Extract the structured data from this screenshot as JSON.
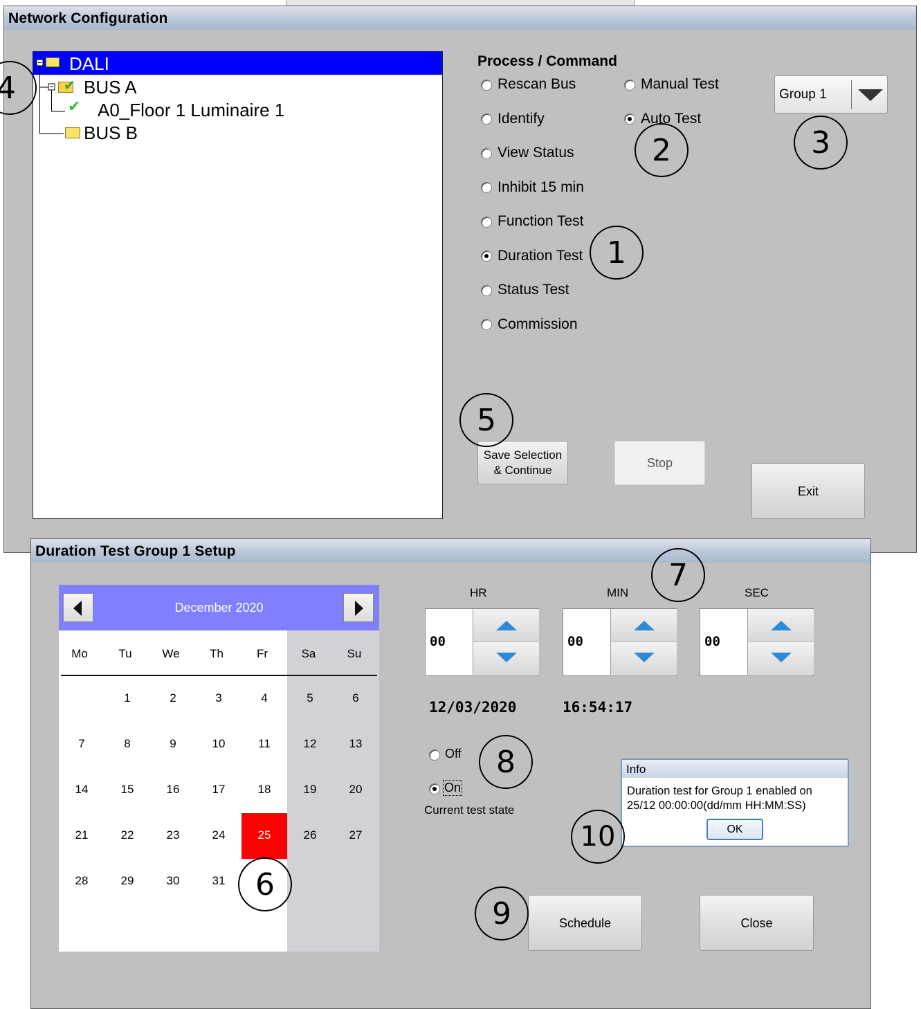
{
  "network_window": {
    "title": "Network Configuration",
    "tree": {
      "root": "DALI",
      "bus_a": "BUS A",
      "device": "A0_Floor 1 Luminaire 1",
      "bus_b": "BUS B"
    },
    "process_heading": "Process / Command",
    "commands_left": [
      "Rescan Bus",
      "Identify",
      "View Status",
      "Inhibit 15 min",
      "Function Test",
      "Duration Test",
      "Status Test",
      "Commission"
    ],
    "commands_right": [
      "Manual Test",
      "Auto Test"
    ],
    "selected_left": "Duration Test",
    "selected_right": "Auto Test",
    "group_dropdown": "Group 1",
    "save_button": "Save Selection\n& Continue",
    "stop_button": "Stop",
    "exit_button": "Exit"
  },
  "setup_window": {
    "title": "Duration Test Group 1 Setup",
    "calendar": {
      "month_label": "December 2020",
      "weekdays": [
        "Mo",
        "Tu",
        "We",
        "Th",
        "Fr",
        "Sa",
        "Su"
      ],
      "weeks": [
        [
          "",
          "1",
          "2",
          "3",
          "4",
          "5",
          "6"
        ],
        [
          "7",
          "8",
          "9",
          "10",
          "11",
          "12",
          "13"
        ],
        [
          "14",
          "15",
          "16",
          "17",
          "18",
          "19",
          "20"
        ],
        [
          "21",
          "22",
          "23",
          "24",
          "25",
          "26",
          "27"
        ],
        [
          "28",
          "29",
          "30",
          "31",
          "",
          "",
          ""
        ]
      ],
      "selected_day": "25",
      "selected_color": "#ff0000"
    },
    "time": {
      "hr_label": "HR",
      "min_label": "MIN",
      "sec_label": "SEC",
      "hr": "00",
      "min": "00",
      "sec": "00"
    },
    "date_display": "12/03/2020",
    "time_display": "16:54:17",
    "state_off": "Off",
    "state_on": "On",
    "state_selected": "On",
    "state_label": "Current test state",
    "schedule_button": "Schedule",
    "close_button": "Close"
  },
  "info_dialog": {
    "title": "Info",
    "message_line1": "Duration test for Group 1 enabled on",
    "message_line2": "25/12 00:00:00(dd/mm HH:MM:SS)",
    "ok_button": "OK"
  },
  "callouts": [
    "1",
    "2",
    "3",
    "4",
    "5",
    "6",
    "7",
    "8",
    "9",
    "10"
  ]
}
